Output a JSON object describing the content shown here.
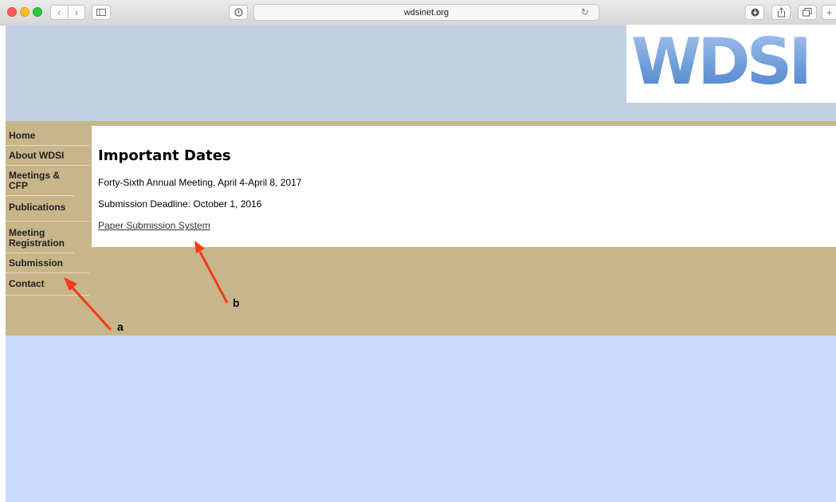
{
  "browser": {
    "url": "wdsinet.org",
    "icons": [
      "sidebar-toggle-icon",
      "info-icon",
      "reload-icon",
      "download-icon",
      "share-icon",
      "tabs-icon"
    ]
  },
  "site": {
    "logo_text": "WDSI",
    "sidebar": {
      "items": [
        {
          "label": "Home"
        },
        {
          "label": "About WDSI"
        },
        {
          "label": "Meetings & CFP"
        },
        {
          "label": "Publications"
        },
        {
          "label": "Meeting Registration"
        },
        {
          "label": "Submission"
        },
        {
          "label": "Contact"
        }
      ]
    },
    "content": {
      "heading": "Important Dates",
      "meeting_line": "Forty-Sixth Annual Meeting, April 4-April 8, 2017",
      "deadline_line": "Submission Deadline: October 1, 2016",
      "link_text": "Paper Submission System"
    }
  },
  "annotations": {
    "label_a": "a",
    "label_b": "b",
    "arrow_color": "#f23b1c"
  },
  "colors": {
    "header_bg": "#c1d1e3",
    "tan": "#c8b58a",
    "page_bg": "#c9dcfb"
  }
}
